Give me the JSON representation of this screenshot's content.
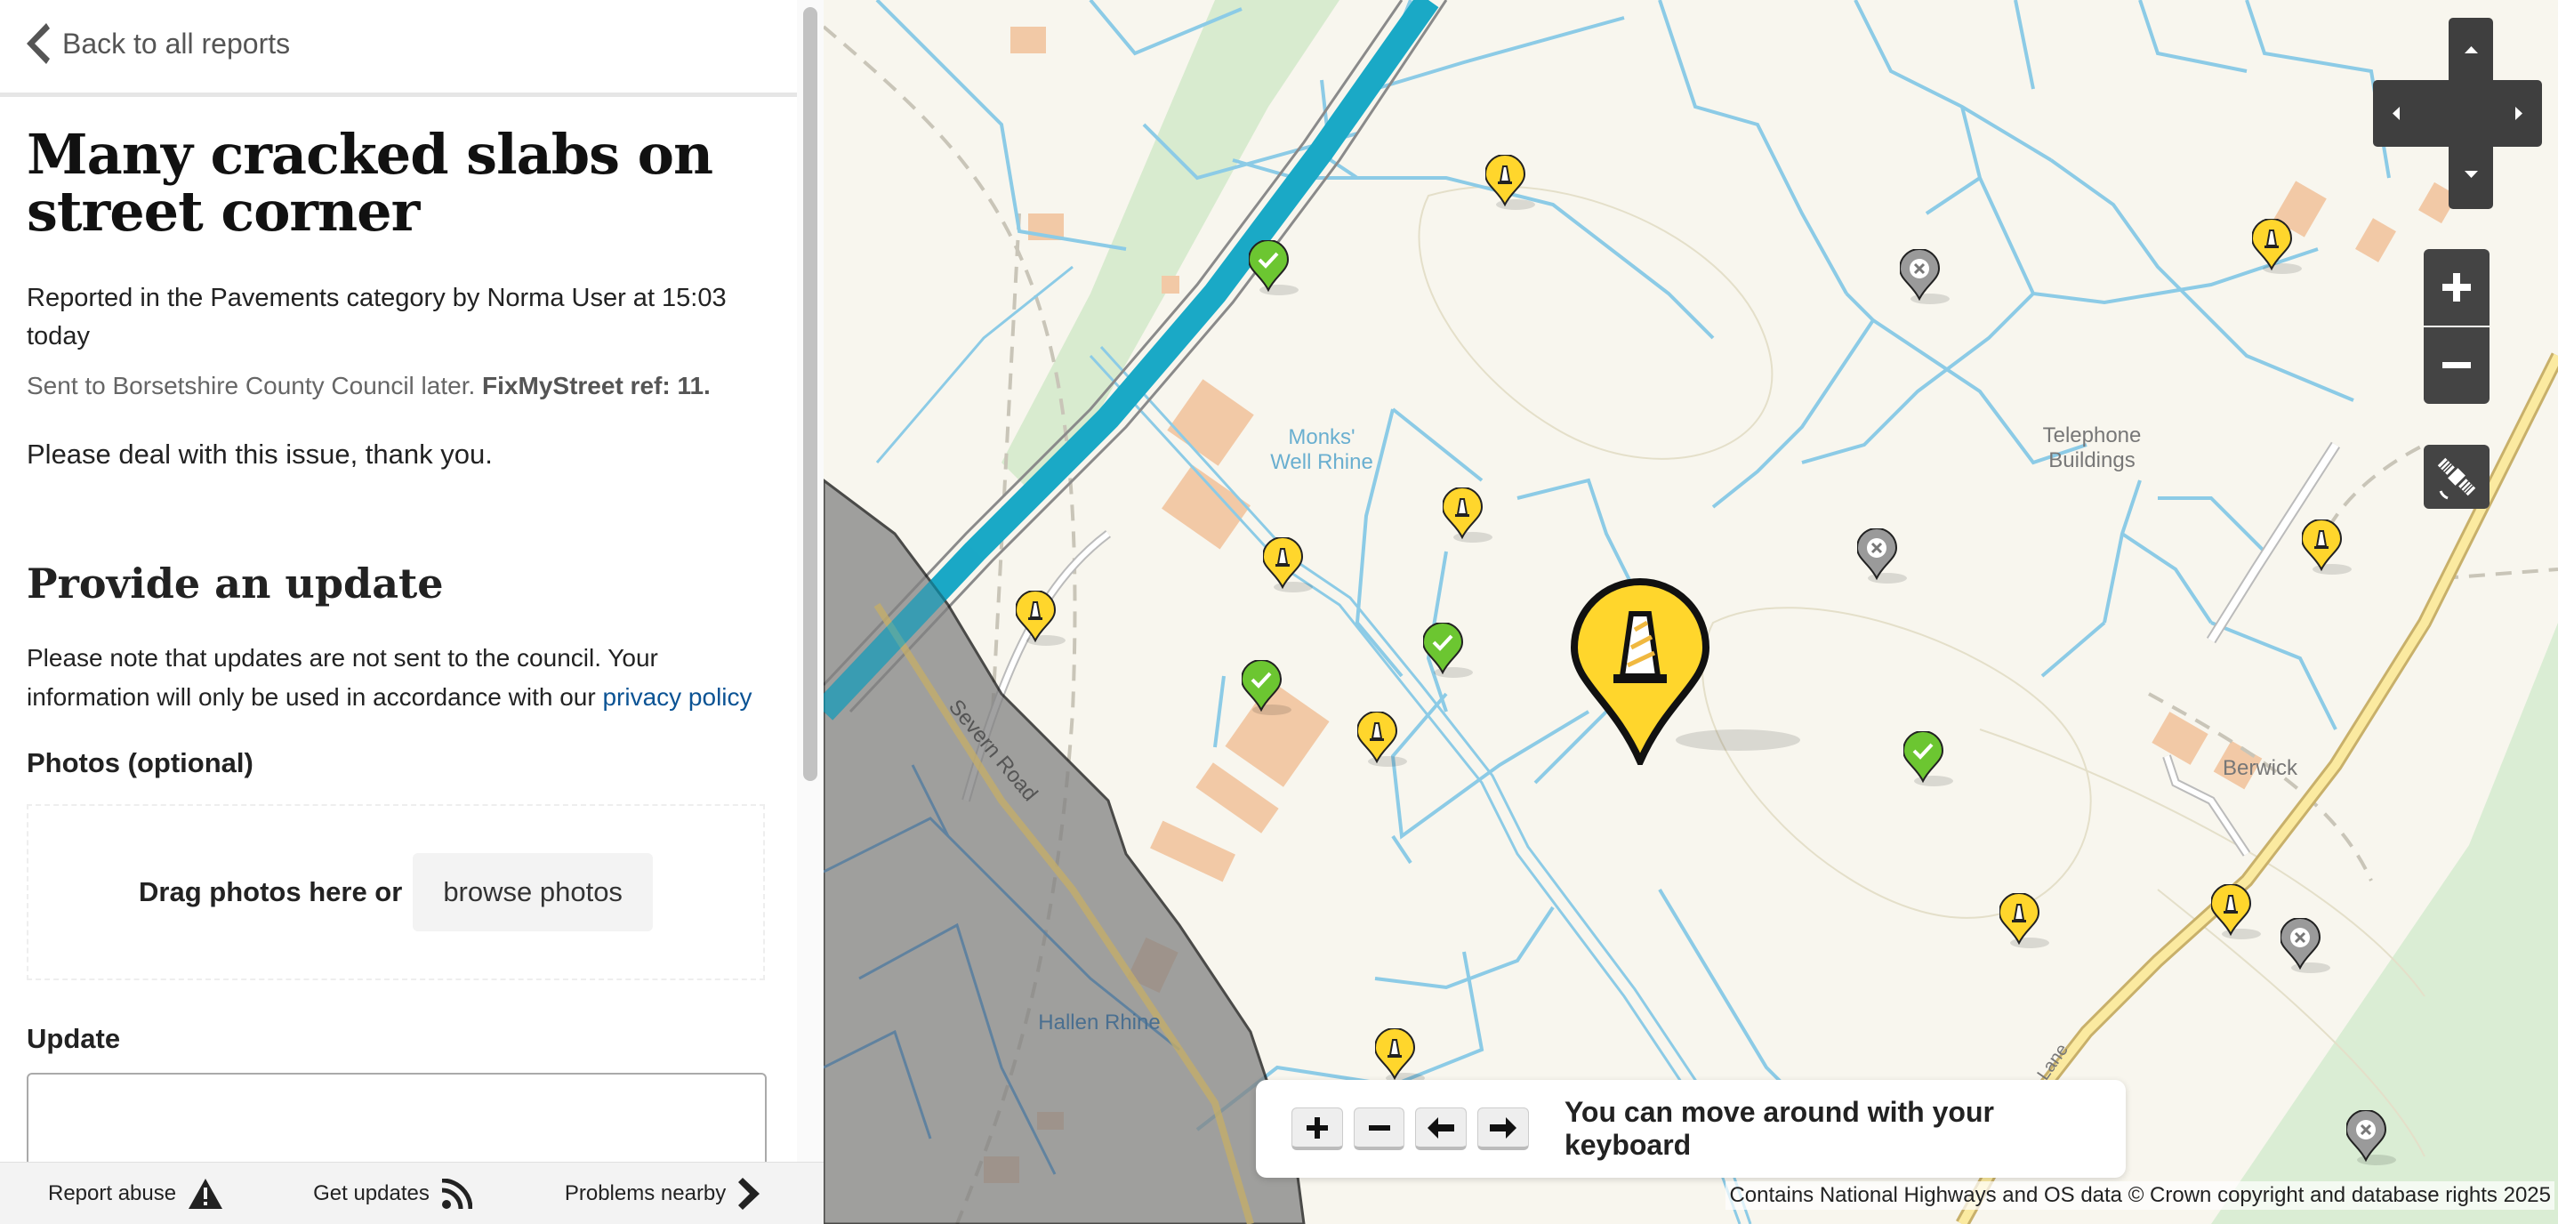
{
  "sidebar": {
    "back_link": "Back to all reports",
    "title": "Many cracked slabs on street corner",
    "meta": "Reported in the Pavements category by Norma User at 15:03 today",
    "sent_prefix": "Sent to Borsetshire County Council later.",
    "sent_ref": "FixMyStreet ref: 11.",
    "detail": "Please deal with this issue, thank you.",
    "update_heading": "Provide an update",
    "note_text": "Please note that updates are not sent to the council. Your information will only be used in accordance with our",
    "privacy_link": "privacy policy",
    "photos_label": "Photos (optional)",
    "drag_text": "Drag photos here or",
    "browse_label": "browse photos",
    "update_label": "Update",
    "update_value": ""
  },
  "footer": {
    "report_abuse": "Report abuse",
    "get_updates": "Get updates",
    "problems_nearby": "Problems nearby"
  },
  "map": {
    "labels": {
      "monks": "Monks' Well Rhine",
      "telephone": "Telephone Buildings",
      "berwick": "Berwick",
      "severn": "Severn Road",
      "hallen": "Hallen Rhine",
      "lane": "Lane"
    },
    "keyboard_hint": "You can move around with your keyboard",
    "attribution": "Contains National Highways and OS data © Crown copyright and database rights 2025",
    "pin_colors": {
      "open": "#ffd62c",
      "fixed": "#6cc631",
      "closed": "#9a9a9a"
    }
  }
}
